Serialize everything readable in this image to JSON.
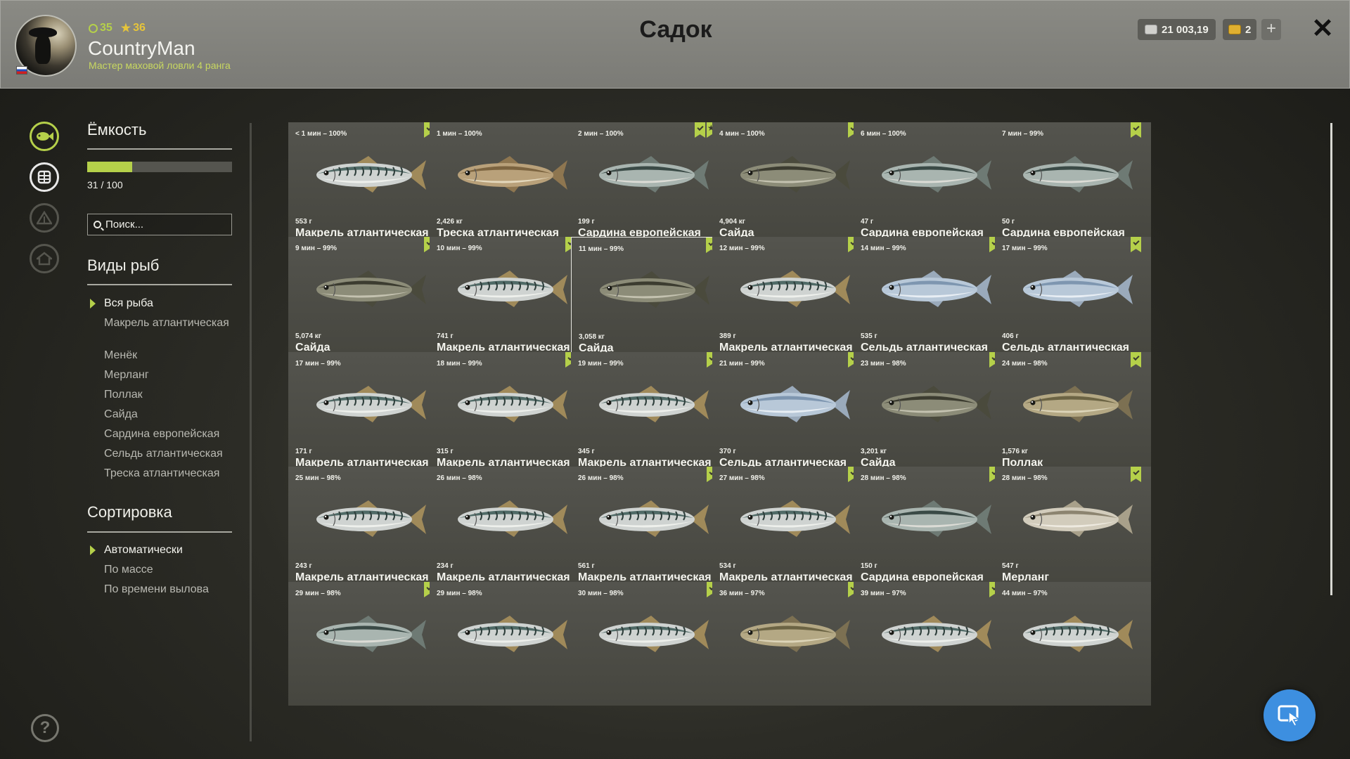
{
  "player": {
    "level": "35",
    "rank_points": "36",
    "name": "CountryMan",
    "title": "Мастер маховой ловли 4 ранга"
  },
  "page_title": "Садок",
  "currency": {
    "silver": "21 003,19",
    "gold": "2",
    "plus_label": "+"
  },
  "close_label": "✕",
  "capacity": {
    "title": "Ёмкость",
    "text": "31 / 100",
    "fill_fraction": 0.31
  },
  "search": {
    "placeholder": "Поиск..."
  },
  "species": {
    "title": "Виды рыб",
    "items": [
      "Вся рыба",
      "Макрель атлантическая",
      "Менёк",
      "Мерланг",
      "Поллак",
      "Сайда",
      "Сардина европейская",
      "Сельдь атлантическая",
      "Треска атлантическая"
    ],
    "active": 0
  },
  "sorting": {
    "title": "Сортировка",
    "items": [
      "Автоматически",
      "По массе",
      "По времени вылова"
    ],
    "active": 0
  },
  "help_label": "?",
  "colors": {
    "accent": "#b5d04a",
    "gold": "#e6c43a",
    "card": "#4c4c46",
    "fab": "#3d8fe0"
  },
  "fish_cards": [
    {
      "time": "< 1 мин – 100%",
      "weight": "553 г",
      "name": "Макрель атлантическая",
      "kind": "mackerel",
      "badges": [
        "check"
      ]
    },
    {
      "time": "1 мин – 100%",
      "weight": "2,426 кг",
      "name": "Треска атлантическая",
      "kind": "cod",
      "badges": []
    },
    {
      "time": "2 мин – 100%",
      "weight": "199 г",
      "name": "Сардина европейская",
      "kind": "sardine",
      "badges": [
        "check",
        "star"
      ]
    },
    {
      "time": "4 мин – 100%",
      "weight": "4,904 кг",
      "name": "Сайда",
      "kind": "saithe",
      "badges": [
        "check"
      ]
    },
    {
      "time": "6 мин – 100%",
      "weight": "47 г",
      "name": "Сардина европейская",
      "kind": "sardine",
      "badges": []
    },
    {
      "time": "7 мин – 99%",
      "weight": "50 г",
      "name": "Сардина европейская",
      "kind": "sardine",
      "badges": [
        "check"
      ]
    },
    {
      "time": "9 мин – 99%",
      "weight": "5,074 кг",
      "name": "Сайда",
      "kind": "saithe",
      "badges": [
        "check"
      ]
    },
    {
      "time": "10 мин – 99%",
      "weight": "741 г",
      "name": "Макрель атлантическая",
      "kind": "mackerel",
      "badges": [
        "check"
      ]
    },
    {
      "time": "11 мин – 99%",
      "weight": "3,058 кг",
      "name": "Сайда",
      "kind": "saithe",
      "badges": [
        "check"
      ],
      "selected": true
    },
    {
      "time": "12 мин – 99%",
      "weight": "389 г",
      "name": "Макрель атлантическая",
      "kind": "mackerel",
      "badges": [
        "check"
      ]
    },
    {
      "time": "14 мин – 99%",
      "weight": "535 г",
      "name": "Сельдь атлантическая",
      "kind": "herring",
      "badges": [
        "check"
      ]
    },
    {
      "time": "17 мин – 99%",
      "weight": "406 г",
      "name": "Сельдь атлантическая",
      "kind": "herring",
      "badges": [
        "check"
      ]
    },
    {
      "time": "17 мин – 99%",
      "weight": "171 г",
      "name": "Макрель атлантическая",
      "kind": "mackerel",
      "badges": []
    },
    {
      "time": "18 мин – 99%",
      "weight": "315 г",
      "name": "Макрель атлантическая",
      "kind": "mackerel",
      "badges": [
        "check"
      ]
    },
    {
      "time": "19 мин – 99%",
      "weight": "345 г",
      "name": "Макрель атлантическая",
      "kind": "mackerel",
      "badges": [
        "check"
      ]
    },
    {
      "time": "21 мин – 99%",
      "weight": "370 г",
      "name": "Сельдь атлантическая",
      "kind": "herring",
      "badges": [
        "check"
      ]
    },
    {
      "time": "23 мин – 98%",
      "weight": "3,201 кг",
      "name": "Сайда",
      "kind": "saithe",
      "badges": [
        "check"
      ]
    },
    {
      "time": "24 мин – 98%",
      "weight": "1,576 кг",
      "name": "Поллак",
      "kind": "pollack",
      "badges": [
        "check"
      ]
    },
    {
      "time": "25 мин – 98%",
      "weight": "243 г",
      "name": "Макрель атлантическая",
      "kind": "mackerel",
      "badges": []
    },
    {
      "time": "26 мин – 98%",
      "weight": "234 г",
      "name": "Макрель атлантическая",
      "kind": "mackerel",
      "badges": []
    },
    {
      "time": "26 мин – 98%",
      "weight": "561 г",
      "name": "Макрель атлантическая",
      "kind": "mackerel",
      "badges": [
        "check"
      ]
    },
    {
      "time": "27 мин – 98%",
      "weight": "534 г",
      "name": "Макрель атлантическая",
      "kind": "mackerel",
      "badges": [
        "check"
      ]
    },
    {
      "time": "28 мин – 98%",
      "weight": "150 г",
      "name": "Сардина европейская",
      "kind": "sardine",
      "badges": [
        "check"
      ]
    },
    {
      "time": "28 мин – 98%",
      "weight": "547 г",
      "name": "Мерланг",
      "kind": "whiting",
      "badges": [
        "check"
      ]
    },
    {
      "time": "29 мин – 98%",
      "weight": "",
      "name": "",
      "kind": "sardine",
      "badges": [
        "check"
      ]
    },
    {
      "time": "29 мин – 98%",
      "weight": "",
      "name": "",
      "kind": "mackerel",
      "badges": []
    },
    {
      "time": "30 мин – 98%",
      "weight": "",
      "name": "",
      "kind": "mackerel",
      "badges": [
        "check"
      ]
    },
    {
      "time": "36 мин – 97%",
      "weight": "",
      "name": "",
      "kind": "pollack",
      "badges": [
        "check"
      ]
    },
    {
      "time": "39 мин – 97%",
      "weight": "",
      "name": "",
      "kind": "mackerel",
      "badges": [
        "check"
      ]
    },
    {
      "time": "44 мин – 97%",
      "weight": "",
      "name": "",
      "kind": "mackerel",
      "badges": []
    }
  ]
}
